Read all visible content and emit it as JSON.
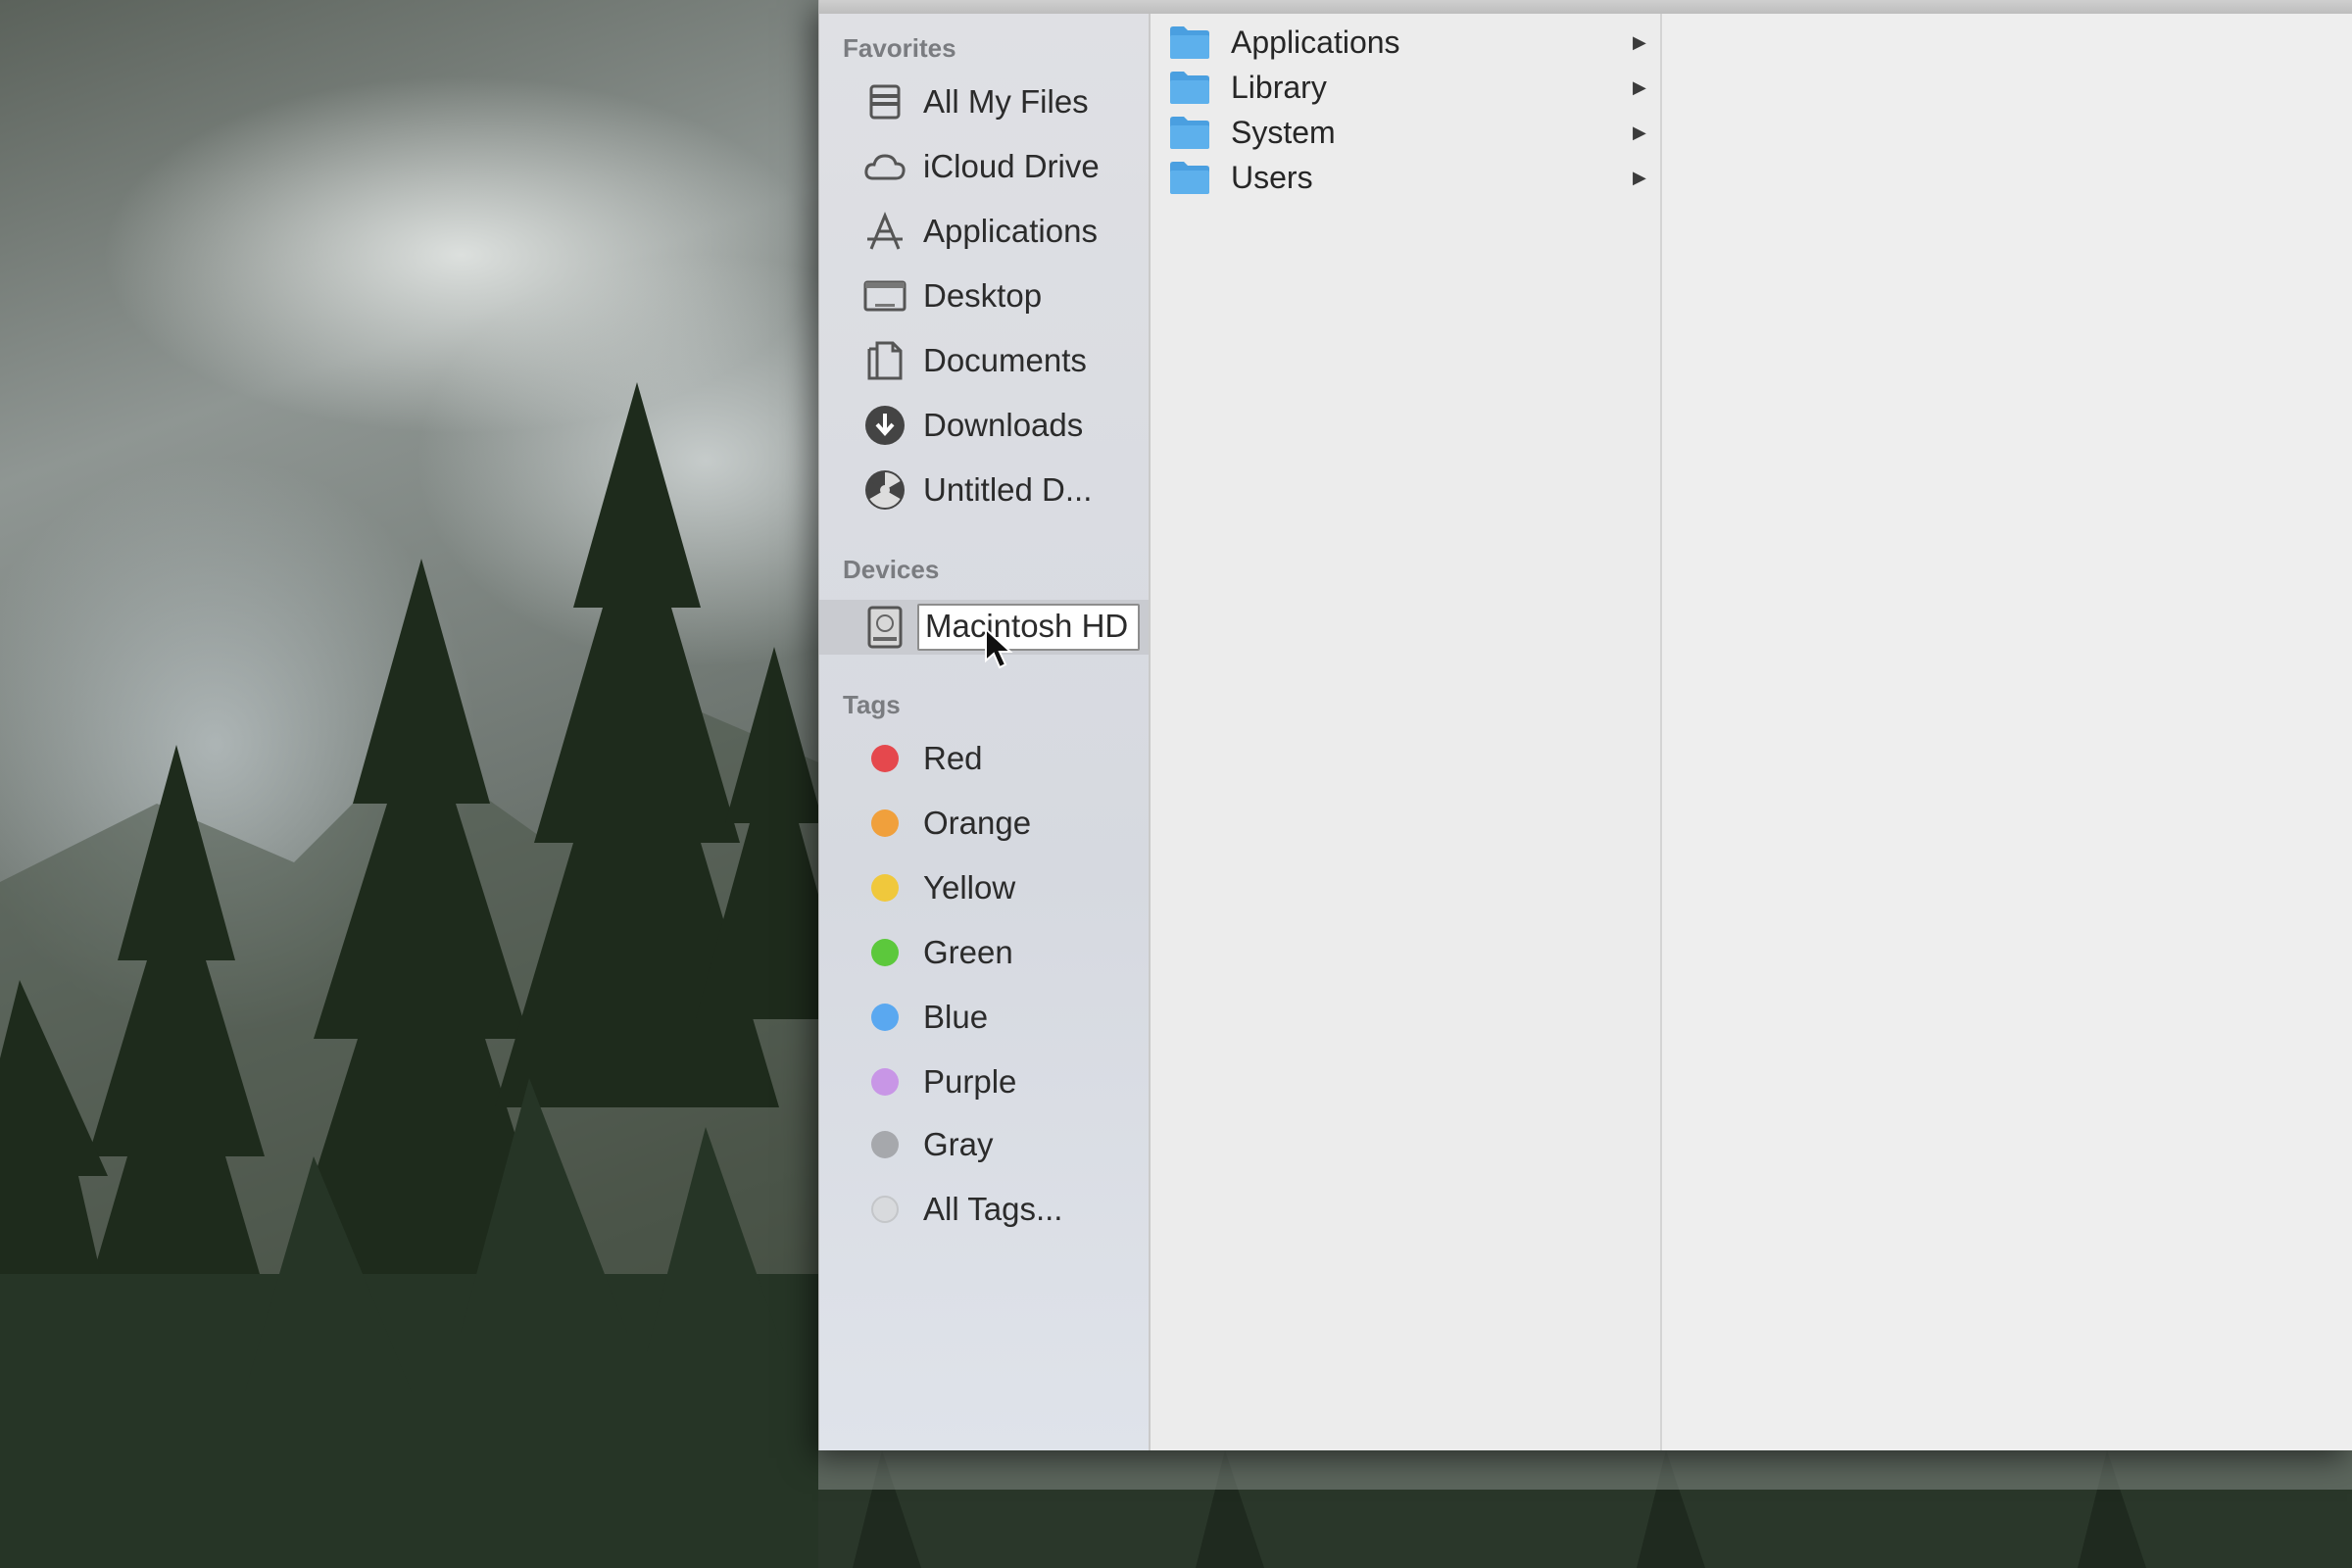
{
  "sidebar": {
    "favorites_header": "Favorites",
    "favorites": [
      {
        "label": "All My Files",
        "icon": "all-my-files-icon"
      },
      {
        "label": "iCloud Drive",
        "icon": "cloud-icon"
      },
      {
        "label": "Applications",
        "icon": "applications-icon"
      },
      {
        "label": "Desktop",
        "icon": "desktop-icon"
      },
      {
        "label": "Documents",
        "icon": "documents-icon"
      },
      {
        "label": "Downloads",
        "icon": "downloads-icon"
      },
      {
        "label": "Untitled D...",
        "icon": "disk-image-icon"
      }
    ],
    "devices_header": "Devices",
    "devices": [
      {
        "label": "Macintosh HD",
        "icon": "hard-drive-icon",
        "selected": true
      }
    ],
    "tags_header": "Tags",
    "tags": [
      {
        "label": "Red",
        "color": "#e5484d"
      },
      {
        "label": "Orange",
        "color": "#f0a03c"
      },
      {
        "label": "Yellow",
        "color": "#f0c83c"
      },
      {
        "label": "Green",
        "color": "#5cc83c"
      },
      {
        "label": "Blue",
        "color": "#5aa8f0"
      },
      {
        "label": "Purple",
        "color": "#c896e6"
      },
      {
        "label": "Gray",
        "color": "#a6a8ac"
      },
      {
        "label": "All Tags...",
        "color": "#d8dadd"
      }
    ]
  },
  "columns": {
    "root_items": [
      {
        "name": "Applications",
        "icon": "folder-icon"
      },
      {
        "name": "Library",
        "icon": "folder-icon"
      },
      {
        "name": "System",
        "icon": "folder-icon"
      },
      {
        "name": "Users",
        "icon": "folder-icon"
      }
    ]
  },
  "colors": {
    "folder_blue": "#4a9fe0",
    "selection_bg": "#c9cbd0"
  }
}
